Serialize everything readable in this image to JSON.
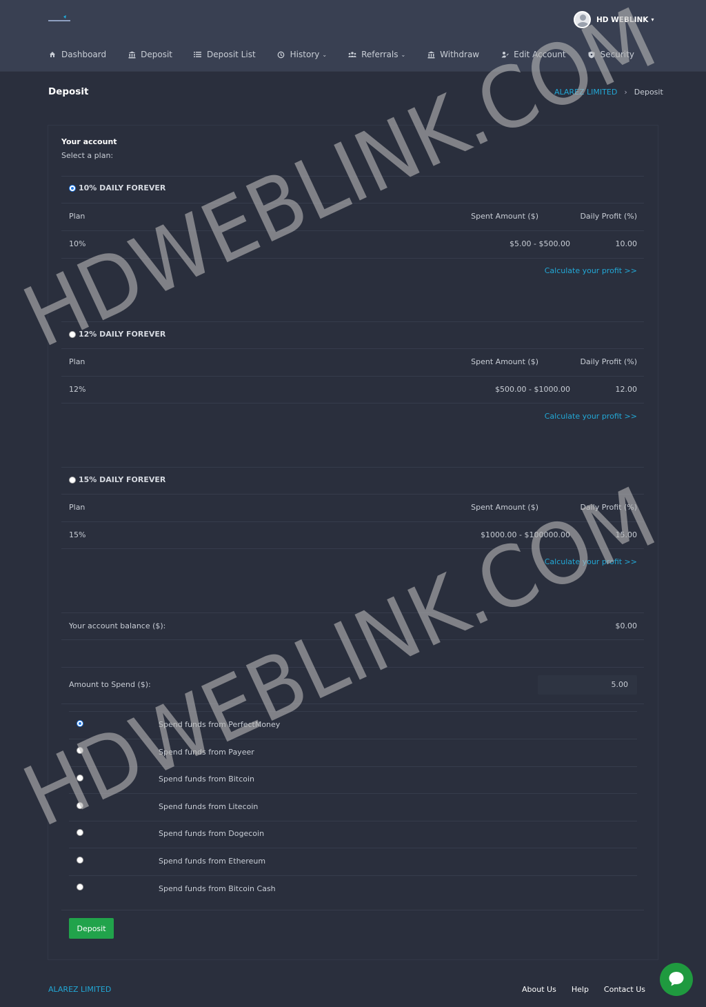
{
  "brand": {
    "logo_text": "ALAREZ LIMITED",
    "accent": "#22a8d6",
    "button_color": "#21a34b"
  },
  "user": {
    "name": "HD WEBLINK"
  },
  "nav": [
    {
      "label": "Dashboard",
      "icon": "home-icon"
    },
    {
      "label": "Deposit",
      "icon": "bank-icon"
    },
    {
      "label": "Deposit List",
      "icon": "list-icon"
    },
    {
      "label": "History",
      "icon": "history-icon",
      "dropdown": true
    },
    {
      "label": "Referrals",
      "icon": "users-icon",
      "dropdown": true
    },
    {
      "label": "Withdraw",
      "icon": "bank-icon"
    },
    {
      "label": "Edit Account",
      "icon": "user-edit-icon"
    },
    {
      "label": "Security",
      "icon": "shield-icon"
    }
  ],
  "page": {
    "title": "Deposit"
  },
  "breadcrumb": {
    "root": "ALAREZ LIMITED",
    "sep": "›",
    "current": "Deposit"
  },
  "account": {
    "title": "Your account",
    "subtitle": "Select a plan:"
  },
  "plans": [
    {
      "name": "10% DAILY FOREVER",
      "selected": true,
      "col_plan": "Plan",
      "col_amount": "Spent Amount ($)",
      "col_profit": "Daily Profit (%)",
      "plan": "10%",
      "range": "$5.00 - $500.00",
      "profit": "10.00",
      "calc": "Calculate your profit >>"
    },
    {
      "name": "12% DAILY FOREVER",
      "selected": false,
      "col_plan": "Plan",
      "col_amount": "Spent Amount ($)",
      "col_profit": "Daily Profit (%)",
      "plan": "12%",
      "range": "$500.00 - $1000.00",
      "profit": "12.00",
      "calc": "Calculate your profit >>"
    },
    {
      "name": "15% DAILY FOREVER",
      "selected": false,
      "col_plan": "Plan",
      "col_amount": "Spent Amount ($)",
      "col_profit": "Daily Profit (%)",
      "plan": "15%",
      "range": "$1000.00 - $100000.00",
      "profit": "15.00",
      "calc": "Calculate your profit >>"
    }
  ],
  "balance": {
    "label": "Your account balance ($):",
    "value": "$0.00"
  },
  "spend": {
    "label": "Amount to Spend ($):",
    "value": "5.00"
  },
  "payment_methods": [
    {
      "label": "Spend funds from PerfectMoney",
      "selected": true
    },
    {
      "label": "Spend funds from Payeer",
      "selected": false
    },
    {
      "label": "Spend funds from Bitcoin",
      "selected": false
    },
    {
      "label": "Spend funds from Litecoin",
      "selected": false
    },
    {
      "label": "Spend funds from Dogecoin",
      "selected": false
    },
    {
      "label": "Spend funds from Ethereum",
      "selected": false
    },
    {
      "label": "Spend funds from Bitcoin Cash",
      "selected": false
    }
  ],
  "deposit_button": "Deposit",
  "footer": {
    "brand": "ALAREZ LIMITED",
    "links": [
      "About Us",
      "Help",
      "Contact Us"
    ]
  },
  "watermark": "HDWEBLINK.COM"
}
